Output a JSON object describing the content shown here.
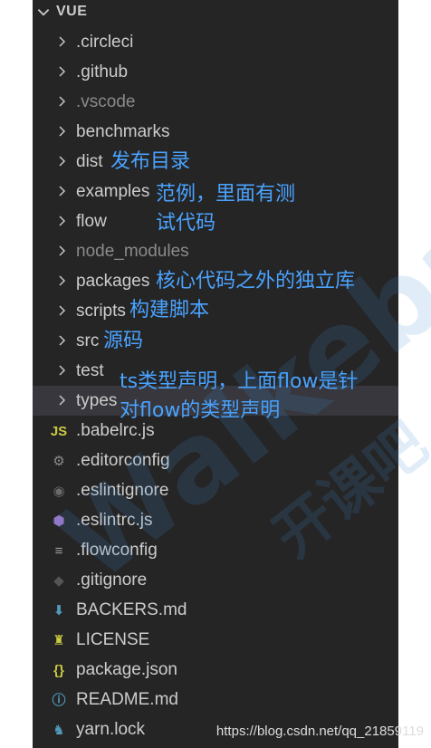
{
  "explorer": {
    "section_title": "VUE",
    "folders": [
      {
        "label": ".circleci",
        "dim": false
      },
      {
        "label": ".github",
        "dim": false
      },
      {
        "label": ".vscode",
        "dim": true
      },
      {
        "label": "benchmarks",
        "dim": false
      },
      {
        "label": "dist",
        "dim": false
      },
      {
        "label": "examples",
        "dim": false
      },
      {
        "label": "flow",
        "dim": false
      },
      {
        "label": "node_modules",
        "dim": true
      },
      {
        "label": "packages",
        "dim": false
      },
      {
        "label": "scripts",
        "dim": false
      },
      {
        "label": "src",
        "dim": false
      },
      {
        "label": "test",
        "dim": false
      },
      {
        "label": "types",
        "dim": false
      }
    ],
    "files": [
      {
        "label": ".babelrc.js",
        "icon": "js-icon",
        "glyph": "JS",
        "color": "#cbcb41"
      },
      {
        "label": ".editorconfig",
        "icon": "gear-icon",
        "glyph": "⚙",
        "color": "#8a8a8a"
      },
      {
        "label": ".eslintignore",
        "icon": "eslint-icon",
        "glyph": "◉",
        "color": "#6a6a6a"
      },
      {
        "label": ".eslintrc.js",
        "icon": "eslint-icon",
        "glyph": "⬢",
        "color": "#a074c4"
      },
      {
        "label": ".flowconfig",
        "icon": "lines-icon",
        "glyph": "≡",
        "color": "#9a9a9a"
      },
      {
        "label": ".gitignore",
        "icon": "git-icon",
        "glyph": "◆",
        "color": "#555555"
      },
      {
        "label": "BACKERS.md",
        "icon": "markdown-icon",
        "glyph": "⬇",
        "color": "#519aba"
      },
      {
        "label": "LICENSE",
        "icon": "license-icon",
        "glyph": "♜",
        "color": "#cbcb41"
      },
      {
        "label": "package.json",
        "icon": "json-icon",
        "glyph": "{}",
        "color": "#cbcb41"
      },
      {
        "label": "README.md",
        "icon": "info-icon",
        "glyph": "ⓘ",
        "color": "#519aba"
      },
      {
        "label": "yarn.lock",
        "icon": "yarn-icon",
        "glyph": "♞",
        "color": "#519aba"
      }
    ]
  },
  "annotations": {
    "dist": "发布目录",
    "examples_line1": "范例，里面有测",
    "examples_line2": "试代码",
    "packages": "核心代码之外的独立库",
    "scripts": "构建脚本",
    "src": "源码",
    "types_line1": "ts类型声明，上面flow是针",
    "types_line2": "对flow的类型声明"
  },
  "watermark": {
    "text": "Waikeba",
    "cn_text": "开课吧",
    "url": "https://blog.csdn.net/qq_21859119"
  },
  "colors": {
    "sidebar_bg": "#252526",
    "text": "#cccccc",
    "dim_text": "#8b8b8b",
    "selected_bg": "#37373d",
    "annotation": "#4aa3ff"
  }
}
